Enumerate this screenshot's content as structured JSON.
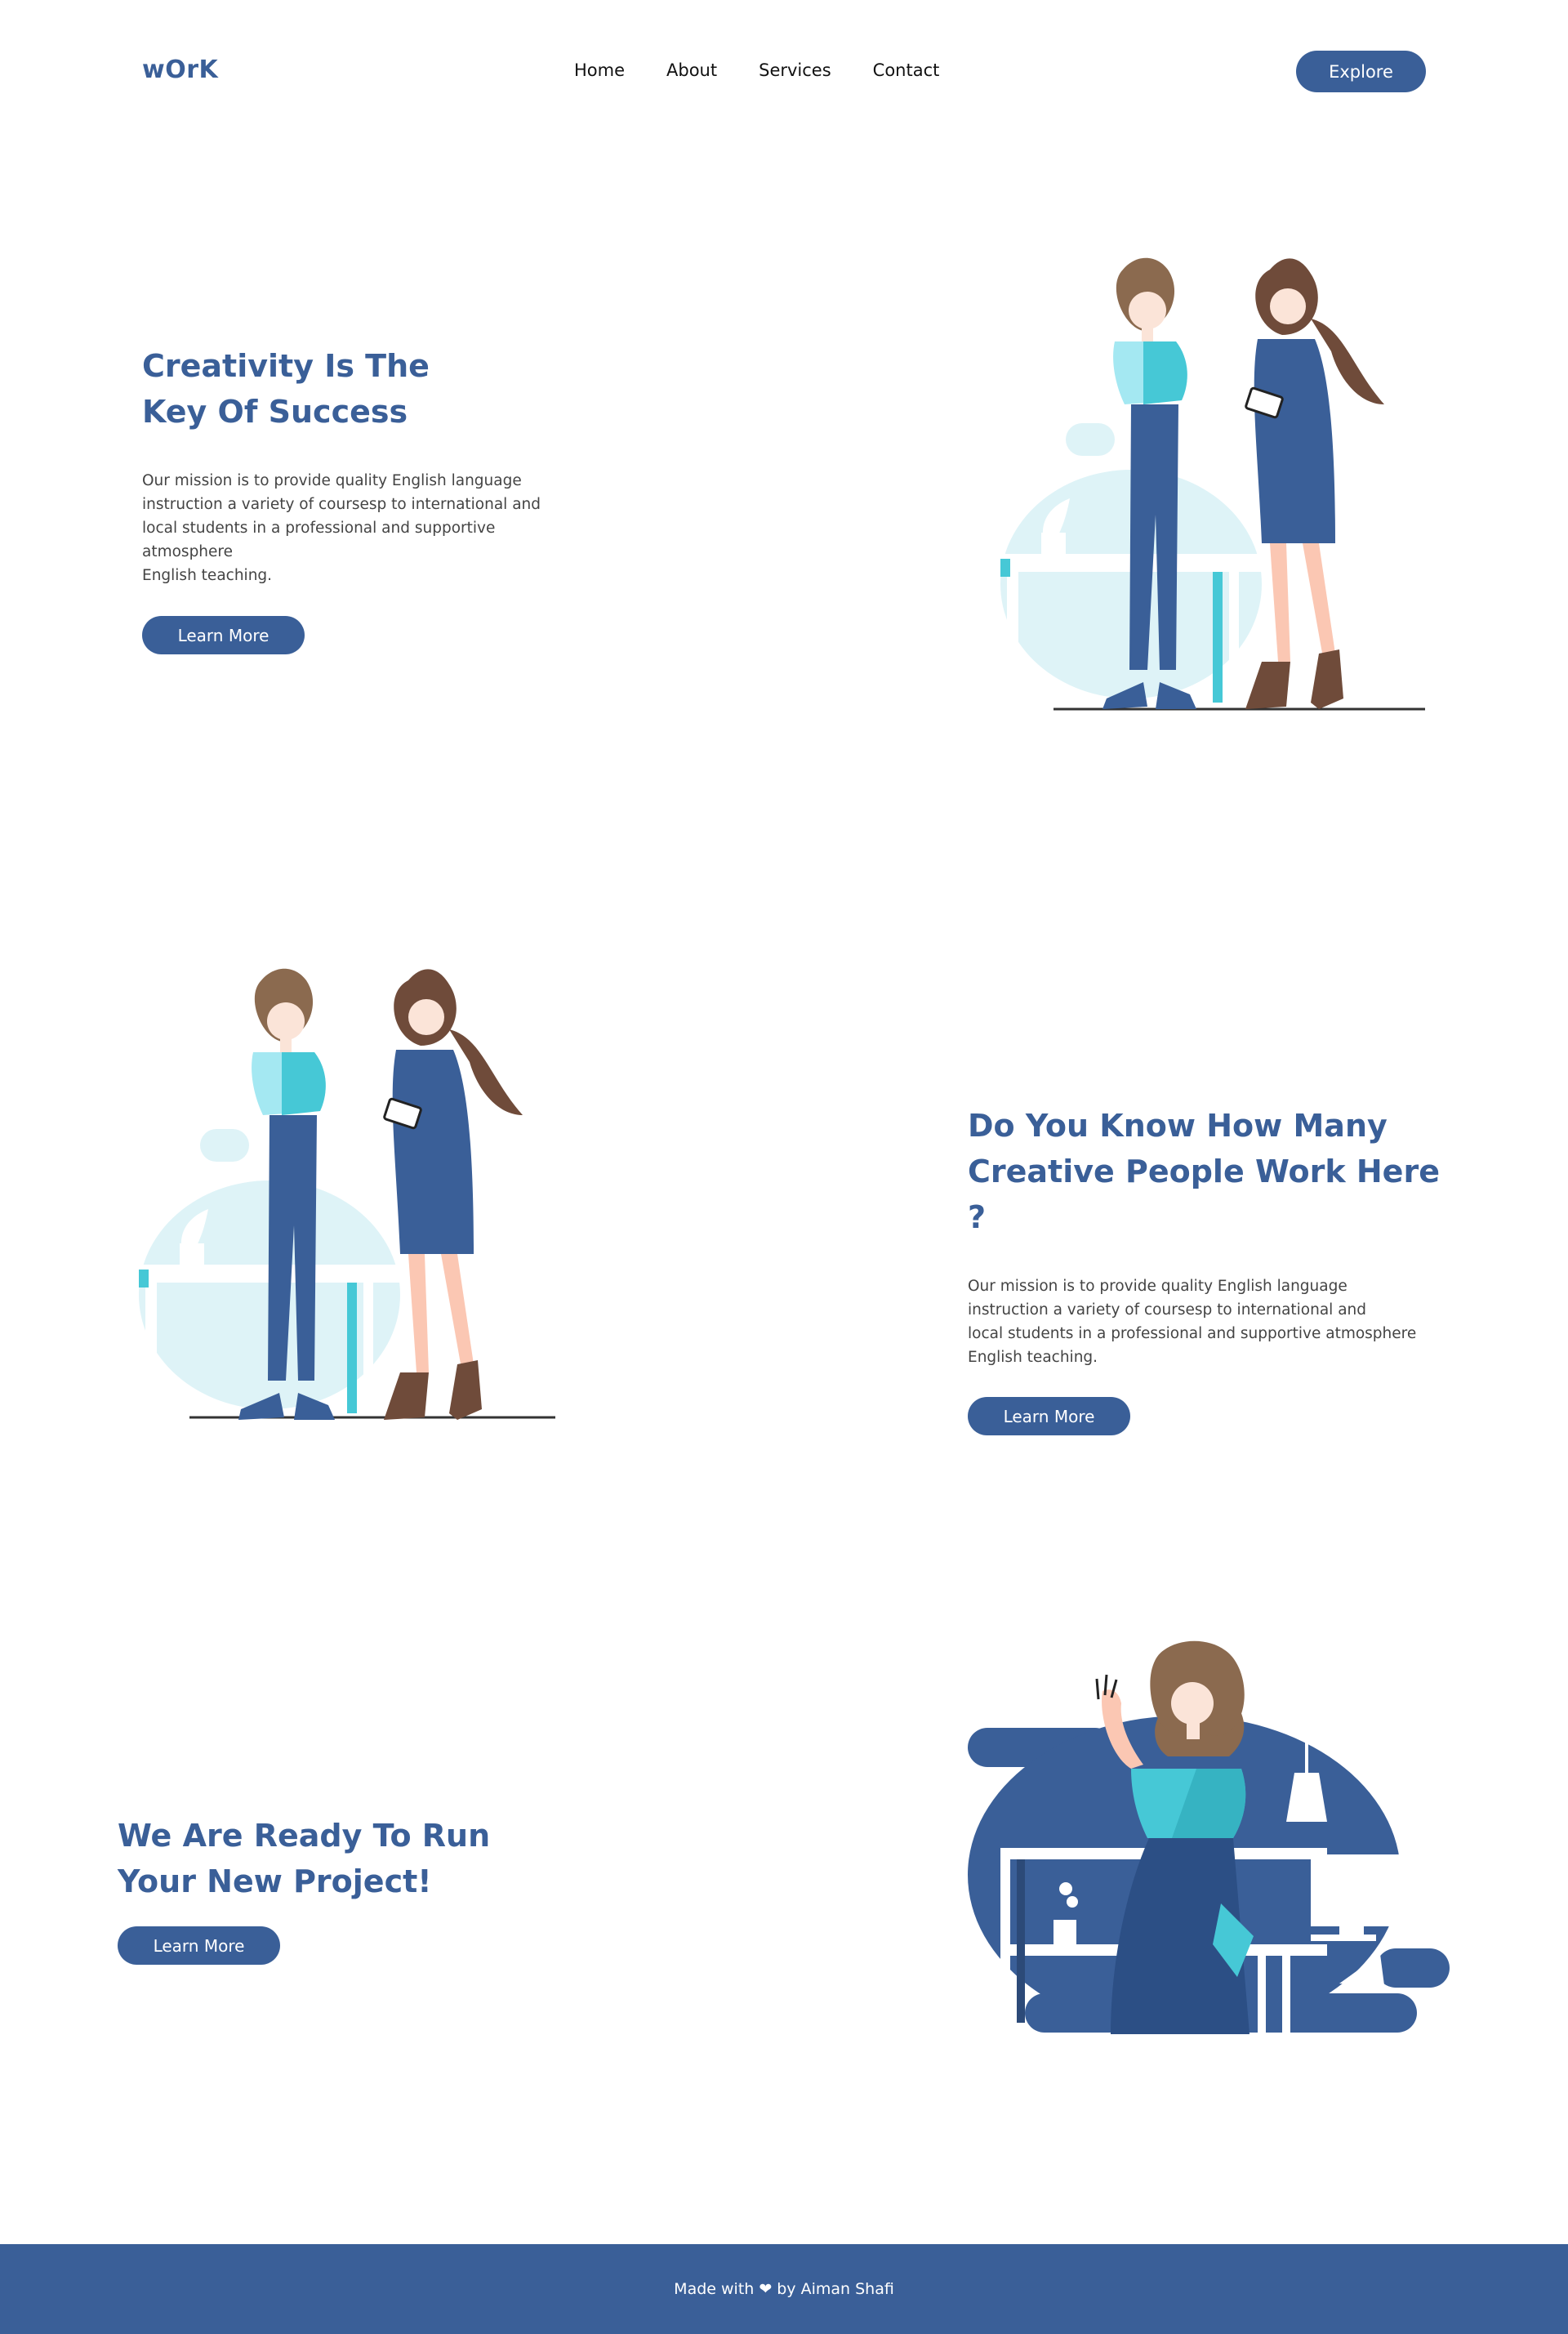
{
  "brand": {
    "logo": "wOrK"
  },
  "nav": {
    "items": [
      {
        "label": "Home"
      },
      {
        "label": "About"
      },
      {
        "label": "Services"
      },
      {
        "label": "Contact"
      }
    ],
    "cta": "Explore"
  },
  "hero": {
    "title_line1": "Creativity Is The",
    "title_line2": "Key Of Success",
    "desc_lines": [
      "Our mission is to provide quality English language",
      "instruction a variety of coursesp to international and",
      "local students in a professional and supportive",
      "atmosphere",
      "English teaching."
    ],
    "button": "Learn More"
  },
  "section2": {
    "title_line1": "Do You Know How Many",
    "title_line2": "Creative People Work Here ?",
    "desc_lines": [
      "Our mission is to provide quality English language",
      "instruction a variety of coursesp to international and",
      "local students in a professional and supportive atmosphere",
      "English teaching."
    ],
    "button": "Learn More"
  },
  "section3": {
    "title_line1": "We Are Ready To Run",
    "title_line2": "Your New Project!",
    "button": "Learn More"
  },
  "footer": {
    "prefix": "Made with",
    "icon": "heart-icon",
    "suffix": "by Aiman Shafi"
  },
  "colors": {
    "primary": "#3a5f98",
    "accent": "#46c8d6",
    "light_bg": "#def3f7"
  }
}
